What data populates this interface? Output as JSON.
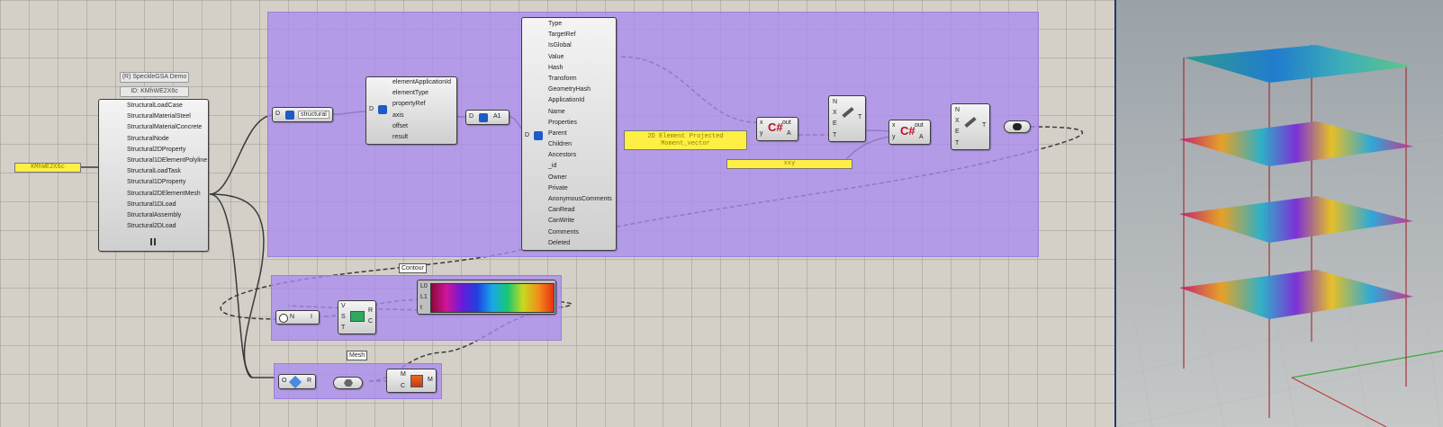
{
  "speckle": {
    "stream_label": "(R) SpeckleGSA Demo",
    "id_label": "ID: KMhWE2X6c",
    "input_panel": "KMhWE2X6c",
    "outputs": [
      "StructuralLoadCase",
      "StructuralMaterialSteel",
      "StructuralMaterialConcrete",
      "StructuralNode",
      "Structural2DProperty",
      "Structural1DElementPolyline",
      "StructuralLoadTask",
      "Structural1DProperty",
      "Structural2DElementMesh",
      "Structural1DLoad",
      "StructuralAssembly",
      "Structural2DLoad"
    ],
    "id_port": "ID"
  },
  "expand1": {
    "in": "D",
    "label": "structural"
  },
  "expand2": {
    "in": "D",
    "outputs": [
      "elementApplicationId",
      "elementType",
      "propertyRef",
      "axis",
      "offset",
      "result"
    ]
  },
  "list_item": {
    "in": "D",
    "out": "A1"
  },
  "expand3": {
    "in": "D",
    "outputs": [
      "Type",
      "TargetRef",
      "IsGlobal",
      "Value",
      "Hash",
      "Transform",
      "GeometryHash",
      "ApplicationId",
      "Name",
      "Properties",
      "Parent",
      "Children",
      "Ancestors",
      "_id",
      "Owner",
      "Private",
      "AnonymousComments",
      "CanRead",
      "CanWrite",
      "Comments",
      "Deleted"
    ]
  },
  "panels": {
    "result_panel": "2D Element Projected Moment_vector",
    "key_panel": "xxy"
  },
  "script1": {
    "in_x": "x",
    "in_y": "y",
    "out": "out",
    "out_a": "A"
  },
  "explode1": {
    "inputs": [
      "N",
      "X",
      "E",
      "T"
    ],
    "out": "T"
  },
  "script2": {
    "in_x": "x",
    "in_y": "y",
    "out": "out",
    "out_a": "A"
  },
  "explode2": {
    "inputs": [
      "N",
      "X",
      "E",
      "T"
    ],
    "out": "T"
  },
  "gradient": {
    "tag": "Contour",
    "ports": [
      "L0",
      "L1",
      "t"
    ]
  },
  "bounds": {
    "ports": [
      "N",
      "I"
    ]
  },
  "remap": {
    "inputs": [
      "V",
      "S",
      "T"
    ],
    "outputs": [
      "R",
      "C"
    ]
  },
  "mesh_group": {
    "tag": "Mesh",
    "o_port": "O",
    "r_port": "R",
    "m_in": "M",
    "c_in": "C",
    "m_out": "M"
  },
  "icons": [
    "speckle-receiver-icon",
    "expand-object-icon",
    "list-item-icon",
    "csharp-script-icon",
    "explode-tree-icon",
    "gradient-icon",
    "bounds-icon",
    "remap-icon",
    "mesh-color-icon"
  ],
  "colors": {
    "group": "#aa8cf0",
    "panel": "#ffef45",
    "canvas": "#d4d0c8"
  }
}
